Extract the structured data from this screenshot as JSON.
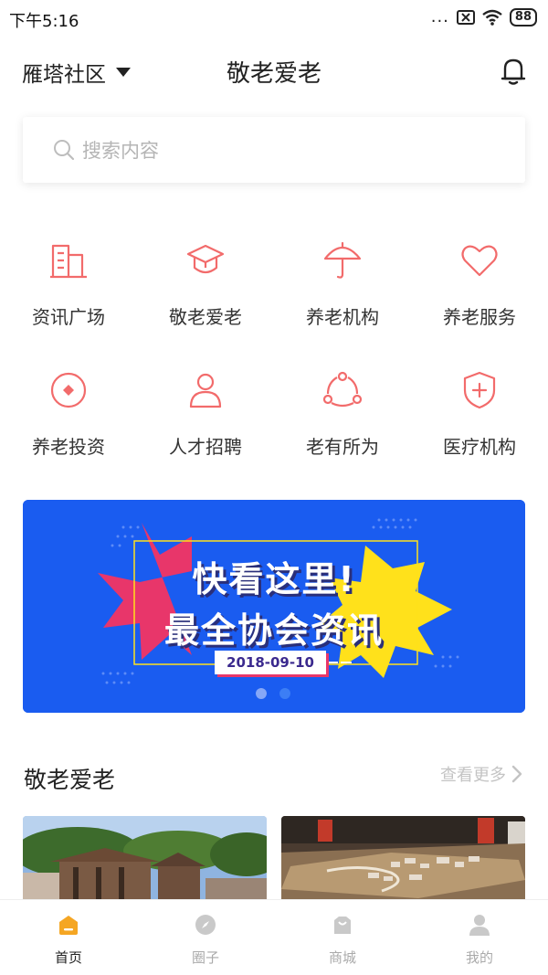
{
  "status_bar": {
    "time": "下午5:16",
    "dots": "...",
    "battery": "88"
  },
  "header": {
    "location": "雁塔社区",
    "title": "敬老爱老"
  },
  "search": {
    "placeholder": "搜索内容"
  },
  "categories": [
    {
      "label": "资讯广场",
      "icon": "building-icon"
    },
    {
      "label": "敬老爱老",
      "icon": "graduation-cap-icon"
    },
    {
      "label": "养老机构",
      "icon": "umbrella-icon"
    },
    {
      "label": "养老服务",
      "icon": "heart-icon"
    },
    {
      "label": "养老投资",
      "icon": "coin-icon"
    },
    {
      "label": "人才招聘",
      "icon": "person-icon"
    },
    {
      "label": "老有所为",
      "icon": "network-icon"
    },
    {
      "label": "医疗机构",
      "icon": "medical-shield-icon"
    }
  ],
  "banner": {
    "headline_1": "快看这里!",
    "headline_2": "最全协会资讯",
    "date": "2018-09-10",
    "slide_count": 2,
    "active_slide": 1
  },
  "section": {
    "title": "敬老爱老",
    "more_label": "查看更多"
  },
  "tabs": [
    {
      "label": "首页",
      "icon": "home-icon",
      "active": true
    },
    {
      "label": "圈子",
      "icon": "compass-icon",
      "active": false
    },
    {
      "label": "商城",
      "icon": "shop-bag-icon",
      "active": false
    },
    {
      "label": "我的",
      "icon": "user-icon",
      "active": false
    }
  ],
  "colors": {
    "accent": "#f26b6b",
    "tab_active": "#f5a623",
    "banner_bg": "#1a5cf0"
  }
}
